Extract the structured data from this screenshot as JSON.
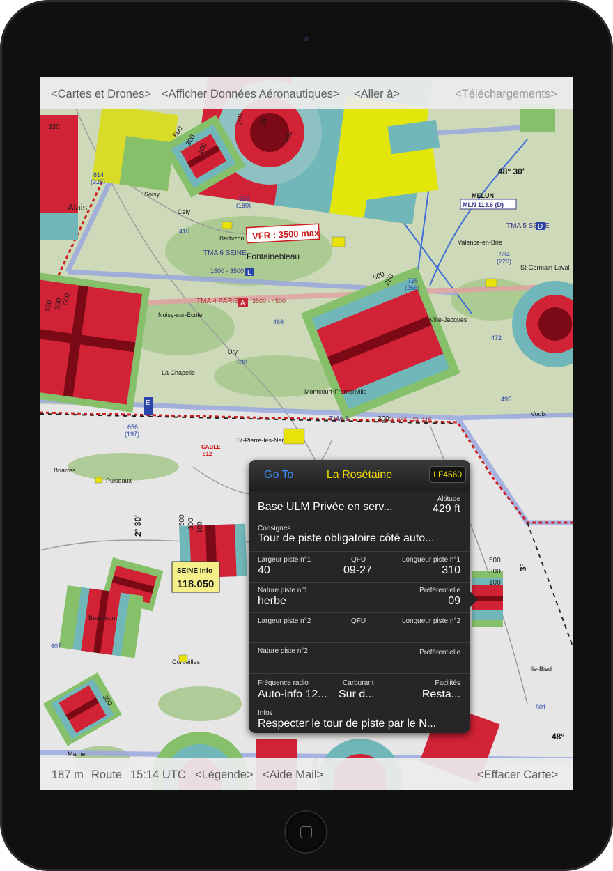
{
  "topbar": {
    "cartes": "<Cartes et Drones>",
    "afficher": "<Afficher Données Aéronautiques>",
    "aller": "<Aller à>",
    "telechargements": "<Téléchargements>"
  },
  "bottombar": {
    "distance": "187 m",
    "route": "Route",
    "time": "15:14 UTC",
    "legende": "<Légende>",
    "aide": "<Aide Mail>",
    "effacer": "<Effacer Carte>"
  },
  "popup": {
    "goto": "Go To",
    "title": "La Rosétaine",
    "code": "LF4560",
    "base": "Base ULM Privée en serv...",
    "altitude_label": "Altitude",
    "altitude_value": "429 ft",
    "consignes_label": "Consignes",
    "consignes_value": "Tour de piste obligatoire côté auto...",
    "largeur1_label": "Largeur piste n°1",
    "largeur1_value": "40",
    "qfu1_label": "QFU",
    "qfu1_value": "09-27",
    "longueur1_label": "Longueur piste n°1",
    "longueur1_value": "310",
    "nature1_label": "Nature piste n°1",
    "nature1_value": "herbe",
    "pref1_label": "Préférentielle",
    "pref1_value": "09",
    "largeur2_label": "Largeur piste n°2",
    "qfu2_label": "QFU",
    "longueur2_label": "Longueur piste n°2",
    "nature2_label": "Nature piste n°2",
    "pref2_label": "Préférentielle",
    "freq_label": "Fréquence radio",
    "freq_value": "Auto-info 12...",
    "carburant_label": "Carburant",
    "carburant_value": "Sur d...",
    "facilites_label": "Facilités",
    "facilites_value": "Resta...",
    "infos_label": "Infos",
    "infos_value": "Respecter le tour de piste par le N..."
  },
  "map": {
    "labels": {
      "vfr": "VFR : 3500 max",
      "fontainebleau": "Fontainebleau",
      "tma6": "TMA 6 SEINE",
      "tma4": "TMA 4 PARIS",
      "tma5": "TMA 5 SEINE",
      "tma8": "TMA 8",
      "alt1500": "1500 - 3500",
      "alt3500": "3500 - 4500",
      "fl": "FL 065 - FL 115",
      "lat1": "48° 30'",
      "lat2": "48°",
      "lon1": "2° 30'",
      "lon2": "3°",
      "melun": "MELUN",
      "mln": "MLN 113.6 (D)",
      "seine_info": "SEINE Info",
      "seine_freq": "118.050",
      "cable": "CABLE",
      "cable_alt": "912",
      "alais": "Alais",
      "nemours": "St-Pierre-les-Nemours",
      "ury": "Ury",
      "chapelle": "La Chapelle",
      "barbizon": "Barbizon",
      "corbeilles": "Corbeilles",
      "beaumont": "Beaumont",
      "montcourt": "Montcourt-Fromonville",
      "bied": "lle-Bied",
      "voulx": "Voulx",
      "st_germain": "St-Germain-Laval",
      "valence": "Valence-en-Brie",
      "ville_jacques": "Ville-Jacques",
      "puiseaux": "Puiseaux",
      "briarres": "Briarres",
      "noisy": "Noisy-sur-Ecole",
      "cely": "Cely",
      "soisy": "Soisy",
      "marne": "Marne",
      "a": "A",
      "e": "E",
      "d": "D",
      "zone_500": "500",
      "zone_300": "300",
      "zone_100": "100",
      "zone_150": "150",
      "zone_50": "50",
      "zone_45": "45",
      "zone_330": "330",
      "zone_250": "250",
      "zone_200": "200",
      "spot_814": "814",
      "spot_325": "(325)",
      "spot_633": "633",
      "spot_180": "(180)",
      "spot_410": "410",
      "spot_725": "725",
      "spot_266": "(266)",
      "spot_472": "472",
      "spot_495": "495",
      "spot_466": "466",
      "spot_538": "538",
      "spot_656": "656",
      "spot_197": "(197)",
      "spot_607": "607",
      "spot_801": "801",
      "spot_594": "594",
      "spot_220": "(220)"
    }
  }
}
